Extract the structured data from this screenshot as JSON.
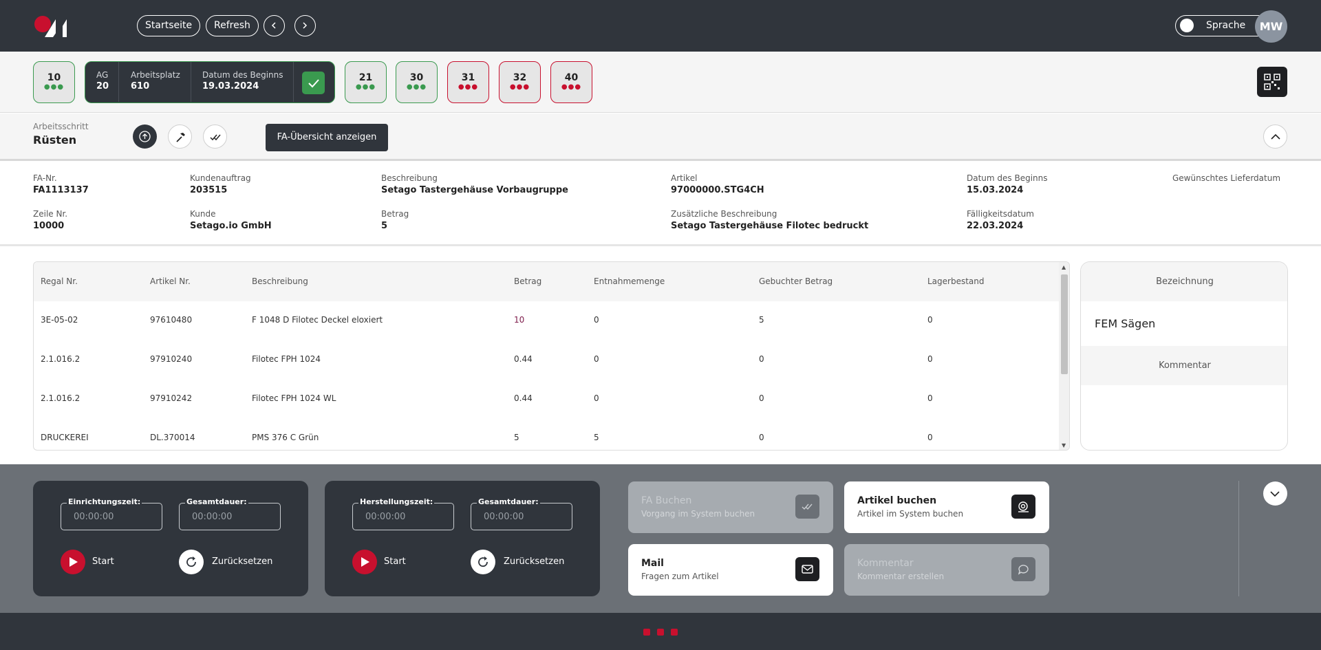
{
  "header": {
    "logo_icon": "company-logo",
    "home_label": "Startseite",
    "refresh_label": "Refresh",
    "prev_icon": "chevron-left-icon",
    "next_icon": "chevron-right-icon",
    "language_label": "Sprache",
    "avatar_initials": "MW"
  },
  "operations": {
    "chips": [
      {
        "number": "10",
        "status": "green"
      },
      {
        "number": "21",
        "status": "green"
      },
      {
        "number": "30",
        "status": "green"
      },
      {
        "number": "31",
        "status": "red"
      },
      {
        "number": "32",
        "status": "red"
      },
      {
        "number": "40",
        "status": "red"
      }
    ],
    "active": {
      "ag_label": "AG",
      "ag_value": "20",
      "workplace_label": "Arbeitsplatz",
      "workplace_value": "610",
      "start_label": "Datum des Beginns",
      "start_value": "19.03.2024"
    },
    "qr_icon": "qr-code-icon",
    "colors": {
      "green": "#3a9a4f",
      "red": "#c8102e",
      "dark": "#30353c"
    }
  },
  "step": {
    "label": "Arbeitsschritt",
    "value": "Rüsten",
    "fa_overview_label": "FA-Übersicht anzeigen"
  },
  "info": {
    "fa_nr": {
      "label": "FA-Nr.",
      "value": "FA1113137"
    },
    "zeile_nr": {
      "label": "Zeile Nr.",
      "value": "10000"
    },
    "kundenauftrag": {
      "label": "Kundenauftrag",
      "value": "203515"
    },
    "kunde": {
      "label": "Kunde",
      "value": "Setago.io GmbH"
    },
    "beschreibung": {
      "label": "Beschreibung",
      "value": "Setago Tastergehäuse Vorbaugruppe"
    },
    "betrag": {
      "label": "Betrag",
      "value": "5"
    },
    "artikel": {
      "label": "Artikel",
      "value": "97000000.STG4CH"
    },
    "zus_beschreibung": {
      "label": "Zusätzliche Beschreibung",
      "value": "Setago Tastergehäuse Filotec bedruckt"
    },
    "datum_beginn": {
      "label": "Datum des Beginns",
      "value": "15.03.2024"
    },
    "faelligkeit": {
      "label": "Fälligkeitsdatum",
      "value": "22.03.2024"
    },
    "lieferdatum": {
      "label": "Gewünschtes Lieferdatum"
    }
  },
  "table": {
    "columns": [
      "Regal Nr.",
      "Artikel Nr.",
      "Beschreibung",
      "Betrag",
      "Entnahmemenge",
      "Gebuchter Betrag",
      "Lagerbestand"
    ],
    "rows": [
      [
        "3E-05-02",
        "97610480",
        "F 1048 D Filotec Deckel eloxiert",
        "10",
        "0",
        "5",
        "0"
      ],
      [
        "2.1.016.2",
        "97910240",
        "Filotec FPH 1024",
        "0.44",
        "0",
        "0",
        "0"
      ],
      [
        "2.1.016.2",
        "97910242",
        "Filotec FPH 1024 WL",
        "0.44",
        "0",
        "0",
        "0"
      ],
      [
        "DRUCKEREI",
        "DL.370014",
        "PMS 376 C Grün",
        "5",
        "5",
        "0",
        "0"
      ]
    ]
  },
  "side": {
    "bezeichnung_label": "Bezeichnung",
    "bezeichnung_value": "FEM Sägen",
    "kommentar_label": "Kommentar"
  },
  "timers": [
    {
      "field1_label": "Einrichtungszeit:",
      "field1_value": "00:00:00",
      "field2_label": "Gesamtdauer:",
      "field2_value": "00:00:00",
      "start_label": "Start",
      "reset_label": "Zurücksetzen"
    },
    {
      "field1_label": "Herstellungszeit:",
      "field1_value": "00:00:00",
      "field2_label": "Gesamtdauer:",
      "field2_value": "00:00:00",
      "start_label": "Start",
      "reset_label": "Zurücksetzen"
    }
  ],
  "actions": [
    {
      "title": "FA Buchen",
      "subtitle": "Vorgang im System buchen",
      "icon": "double-check-icon",
      "enabled": false
    },
    {
      "title": "Artikel buchen",
      "subtitle": "Artikel im System buchen",
      "icon": "scan-icon",
      "enabled": true
    },
    {
      "title": "Mail",
      "subtitle": "Fragen zum Artikel",
      "icon": "mail-icon",
      "enabled": true
    },
    {
      "title": "Kommentar",
      "subtitle": "Kommentar erstellen",
      "icon": "comment-icon",
      "enabled": false
    }
  ]
}
